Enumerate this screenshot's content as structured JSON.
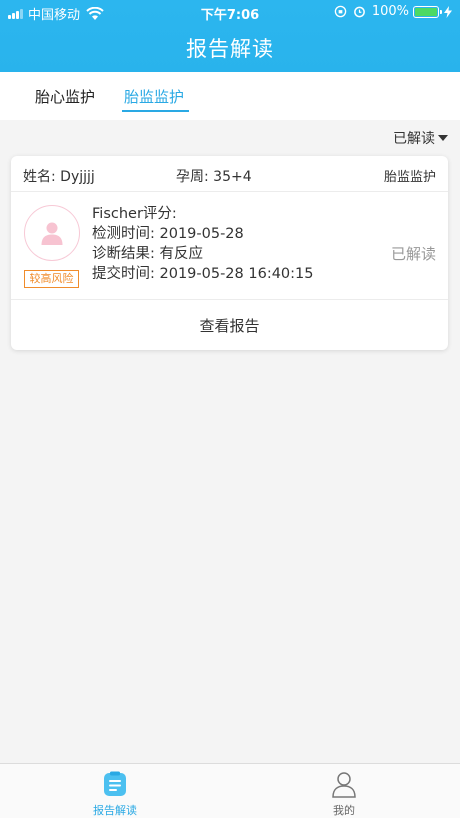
{
  "status_bar": {
    "carrier": "中国移动",
    "time": "下午7:06",
    "battery": "100%"
  },
  "nav": {
    "title": "报告解读"
  },
  "tabs": [
    {
      "label": "胎心监护",
      "active": false
    },
    {
      "label": "胎监监护",
      "active": true
    }
  ],
  "filter": {
    "label": "已解读"
  },
  "record": {
    "name_label": "姓名:  Dyjjjj",
    "week_label": "孕周:  35+4",
    "type_label": "胎监监护",
    "risk_badge": "较高风险",
    "fischer_score": "Fischer评分:",
    "detect_time": "检测时间:  2019-05-28",
    "diagnosis": "诊断结果:  有反应",
    "submit_time": "提交时间:  2019-05-28 16:40:15",
    "status": "已解读",
    "view_button": "查看报告"
  },
  "bottom_tabs": [
    {
      "label": "报告解读",
      "active": true,
      "icon": "report-icon"
    },
    {
      "label": "我的",
      "active": false,
      "icon": "profile-icon"
    }
  ],
  "colors": {
    "primary": "#2aa9e4",
    "header": "#2cb6ef",
    "risk": "#f08c2b",
    "avatar": "#f7c9d6"
  }
}
